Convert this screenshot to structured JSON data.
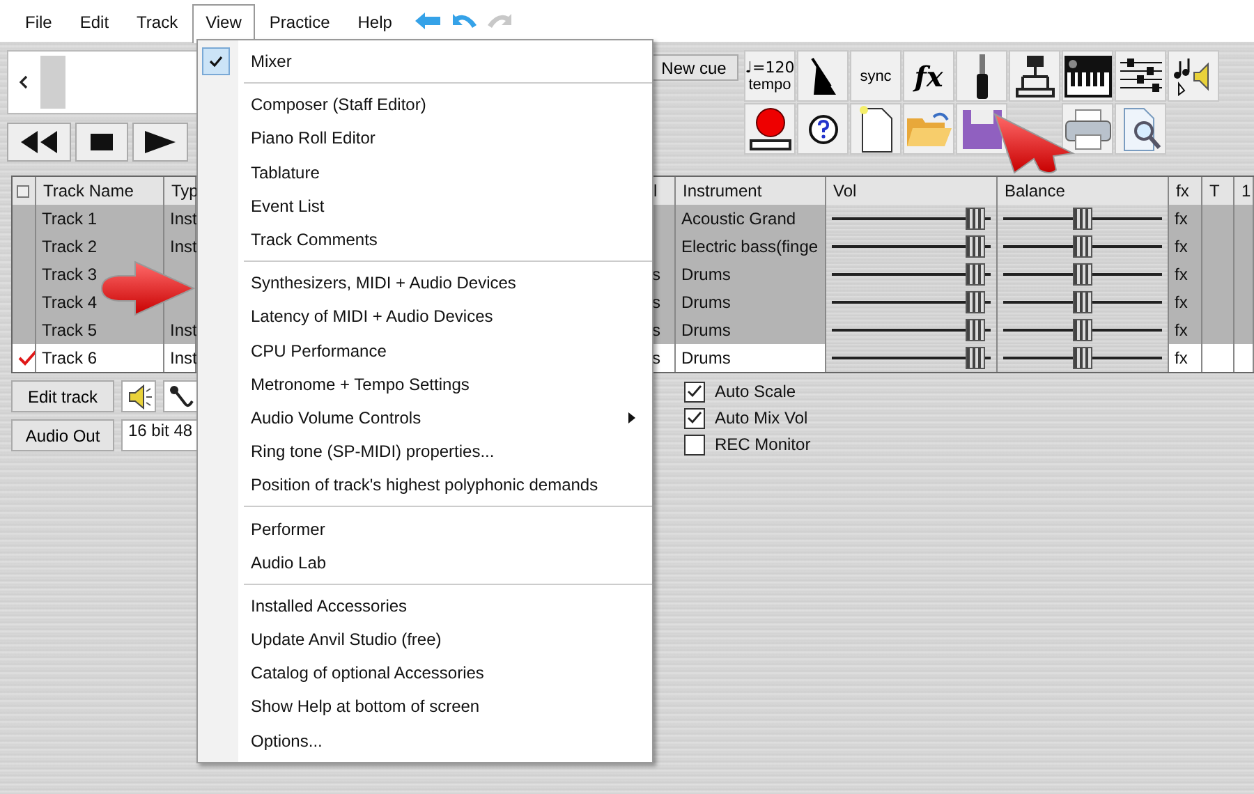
{
  "menu_bar": [
    {
      "label": "File",
      "selected": false
    },
    {
      "label": "Edit",
      "selected": false
    },
    {
      "label": "Track",
      "selected": false
    },
    {
      "label": "View",
      "selected": true
    },
    {
      "label": "Practice",
      "selected": false
    },
    {
      "label": "Help",
      "selected": false
    }
  ],
  "new_cue": "New cue",
  "toolbar": {
    "tempo_note": "♩=120",
    "tempo_label": "tempo",
    "sync_label": "sync",
    "fx_label": "fx"
  },
  "select_all": {
    "checked": false
  },
  "columns": [
    "Track Name",
    "Typ",
    "l",
    "Instrument",
    "Vol",
    "Balance",
    "fx",
    "T",
    "1"
  ],
  "tracks": [
    {
      "name": "Track 1",
      "type": "Inst",
      "instrument": "Acoustic Grand",
      "vol": {
        "level": 0.9
      },
      "balance": {
        "level": 0.5
      },
      "fx": "fx",
      "selected": false
    },
    {
      "name": "Track 2",
      "type": "Inst",
      "instrument": "Electric bass(finge",
      "vol": {
        "level": 0.9
      },
      "balance": {
        "level": 0.5
      },
      "fx": "fx",
      "selected": false
    },
    {
      "name": "Track 3",
      "column_4": "s",
      "instrument": "Drums",
      "vol": {
        "level": 0.9
      },
      "balance": {
        "level": 0.5
      },
      "fx": "fx",
      "selected": false
    },
    {
      "name": "Track 4",
      "column_4": "s",
      "instrument": "Drums",
      "vol": {
        "level": 0.9
      },
      "balance": {
        "level": 0.5
      },
      "fx": "fx",
      "selected": false
    },
    {
      "name": "Track 5",
      "type": "Inst",
      "column_4": "s",
      "instrument": "Drums",
      "vol": {
        "level": 0.9
      },
      "balance": {
        "level": 0.5
      },
      "fx": "fx",
      "selected": false
    },
    {
      "name": "Track 6",
      "type": "Inst",
      "column_4": "s",
      "instrument": "Drums",
      "vol": {
        "level": 0.9
      },
      "balance": {
        "level": 0.5
      },
      "fx": "fx",
      "selected": true
    }
  ],
  "edit_track": "Edit track",
  "audio_out": "Audio Out",
  "audio_format": "16 bit 48",
  "options": [
    {
      "label": "Auto Scale",
      "checked": true
    },
    {
      "label": "Auto Mix Vol",
      "checked": true
    },
    {
      "label": "REC Monitor",
      "checked": false
    }
  ],
  "view_menu": {
    "groups": [
      [
        {
          "label": "Mixer",
          "checked": true,
          "submenu": false
        }
      ],
      [
        {
          "label": "Composer (Staff Editor)",
          "checked": false,
          "submenu": false
        },
        {
          "label": "Piano Roll Editor",
          "checked": false,
          "submenu": false
        },
        {
          "label": "Tablature",
          "checked": false,
          "submenu": false
        },
        {
          "label": "Event List",
          "checked": false,
          "submenu": false
        },
        {
          "label": "Track Comments",
          "checked": false,
          "submenu": false
        }
      ],
      [
        {
          "label": "Synthesizers, MIDI + Audio Devices",
          "checked": false,
          "submenu": false
        },
        {
          "label": "Latency of MIDI + Audio Devices",
          "checked": false,
          "submenu": false
        },
        {
          "label": "CPU Performance",
          "checked": false,
          "submenu": false
        },
        {
          "label": "Metronome + Tempo Settings",
          "checked": false,
          "submenu": false
        },
        {
          "label": "Audio Volume Controls",
          "checked": false,
          "submenu": true
        },
        {
          "label": "Ring tone (SP-MIDI) properties...",
          "checked": false,
          "submenu": false
        },
        {
          "label": "Position of track's highest polyphonic demands",
          "checked": false,
          "submenu": false
        }
      ],
      [
        {
          "label": "Performer",
          "checked": false,
          "submenu": false
        },
        {
          "label": "Audio Lab",
          "checked": false,
          "submenu": false
        }
      ],
      [
        {
          "label": "Installed Accessories",
          "checked": false,
          "submenu": false
        },
        {
          "label": "Update Anvil Studio (free)",
          "checked": false,
          "submenu": false
        },
        {
          "label": "Catalog of optional Accessories",
          "checked": false,
          "submenu": false
        },
        {
          "label": "Show Help at bottom of screen",
          "checked": false,
          "submenu": false
        },
        {
          "label": "Options...",
          "checked": false,
          "submenu": false
        }
      ]
    ]
  }
}
